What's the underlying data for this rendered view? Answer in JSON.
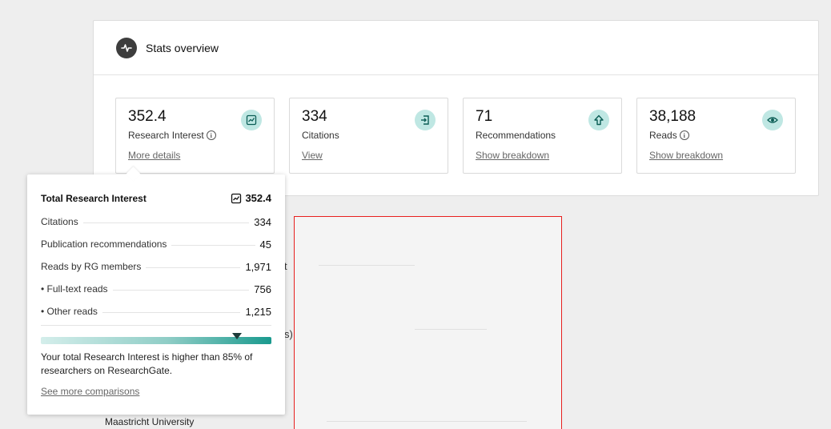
{
  "stats": {
    "title": "Stats overview",
    "tiles": [
      {
        "value": "352.4",
        "label": "Research Interest",
        "link": "More details",
        "icon": "research-interest-icon"
      },
      {
        "value": "334",
        "label": "Citations",
        "link": "View",
        "icon": "citation-icon"
      },
      {
        "value": "71",
        "label": "Recommendations",
        "link": "Show breakdown",
        "icon": "arrow-up-icon"
      },
      {
        "value": "38,188",
        "label": "Reads",
        "link": "Show breakdown",
        "icon": "eye-icon"
      }
    ]
  },
  "tooltip": {
    "title": "Total Research Interest",
    "total": "352.4",
    "rows": [
      {
        "label": "Citations",
        "value": "334"
      },
      {
        "label": "Publication recommendations",
        "value": "45"
      },
      {
        "label": "Reads by RG members",
        "value": "1,971"
      },
      {
        "label": "• Full-text reads",
        "value": "756"
      },
      {
        "label": "• Other reads",
        "value": "1,215"
      }
    ],
    "percentile": 85,
    "description": "Your total Research Interest is higher than 85% of researchers on ResearchGate.",
    "link": "See more comparisons"
  },
  "background": {
    "affiliation": "Maastricht University",
    "fragment": "s)",
    "fragment2": "t"
  },
  "colors": {
    "accent": "#1a9a8e",
    "icon_bg": "#bfe7e3",
    "highlight_box": "#e8201e"
  }
}
